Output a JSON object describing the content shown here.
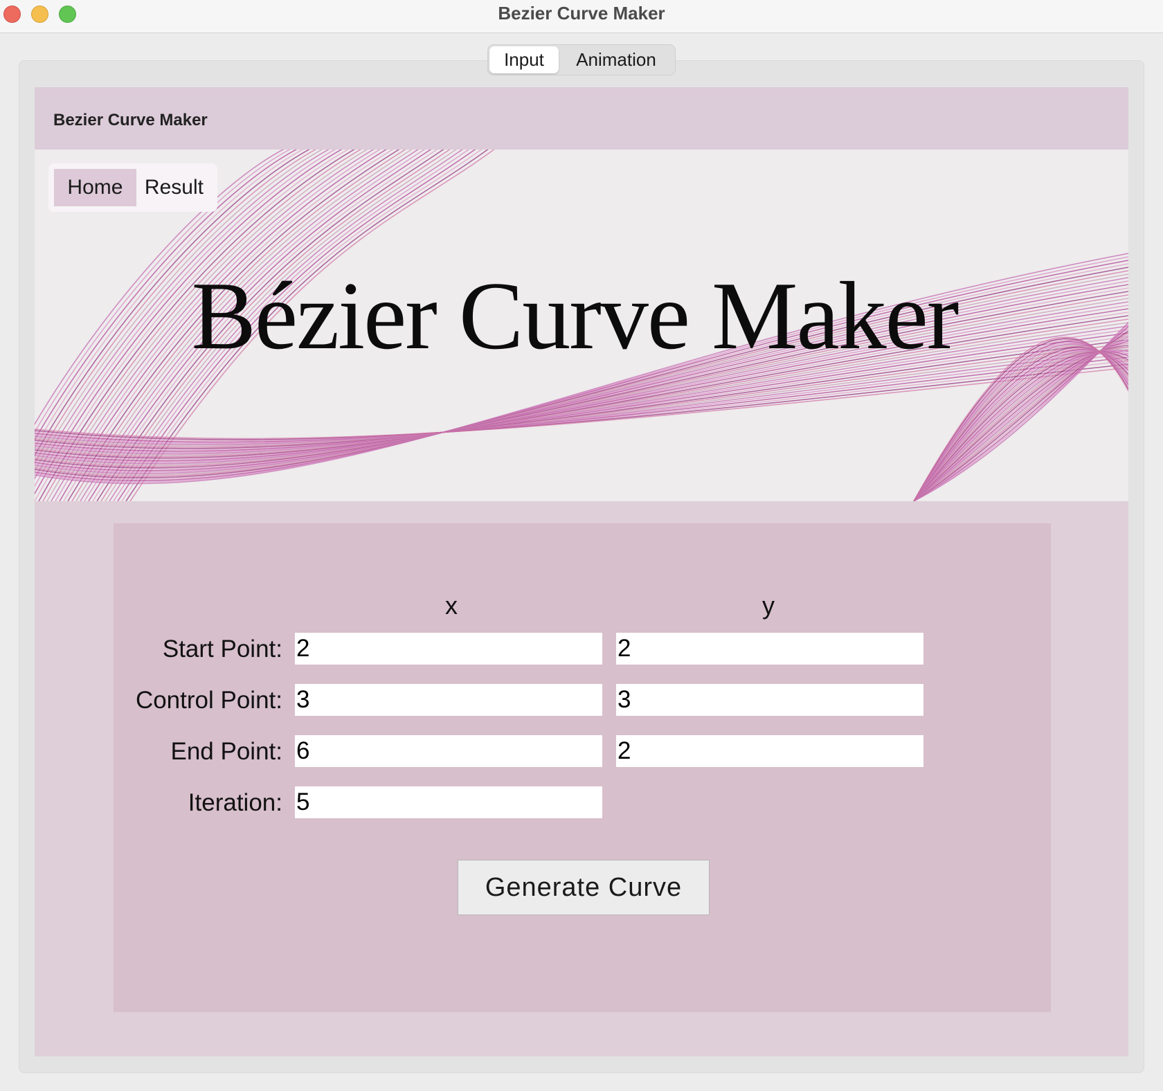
{
  "window": {
    "title": "Bezier Curve Maker"
  },
  "tabs": [
    {
      "label": "Input",
      "selected": true
    },
    {
      "label": "Animation",
      "selected": false
    }
  ],
  "app": {
    "header_title": "Bezier Curve Maker",
    "banner_title": "Bézier Curve Maker",
    "nav": {
      "home": "Home",
      "result": "Result",
      "active": "Home"
    }
  },
  "form": {
    "columns": {
      "x": "x",
      "y": "y"
    },
    "start": {
      "label": "Start Point:",
      "x": "2",
      "y": "2"
    },
    "control": {
      "label": "Control Point:",
      "x": "3",
      "y": "3"
    },
    "end": {
      "label": "End Point:",
      "x": "6",
      "y": "2"
    },
    "iteration": {
      "label": "Iteration:",
      "value": "5"
    },
    "generate_label": "Generate Curve"
  },
  "colors": {
    "header": "#dccbd8",
    "panel": "#d7bfcb",
    "background": "#dfcfd8",
    "nav_active": "#ddc9d7"
  }
}
